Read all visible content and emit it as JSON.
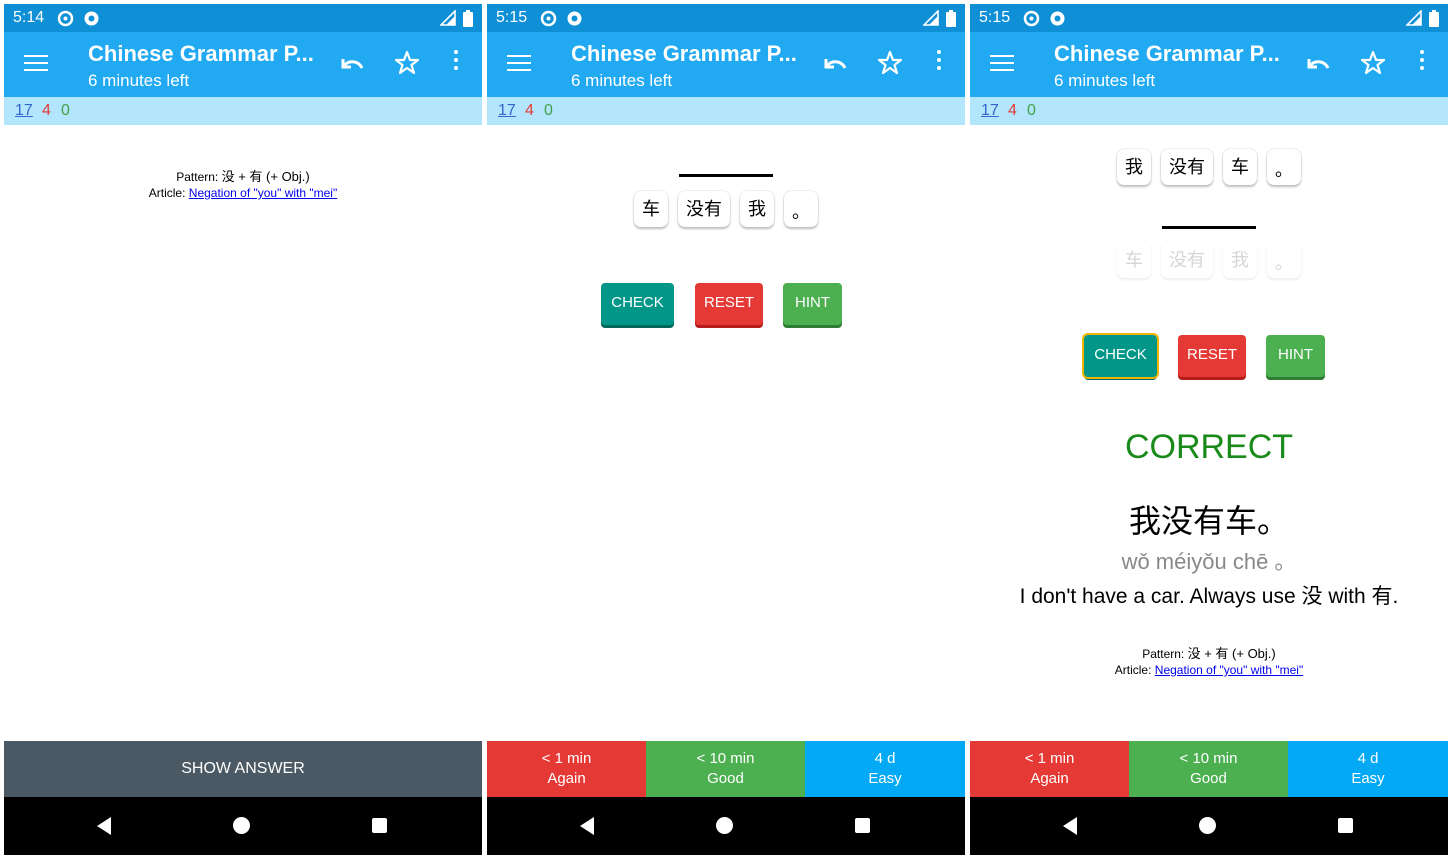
{
  "status": {
    "time1": "5:14",
    "time2": "5:15",
    "time3": "5:15"
  },
  "app": {
    "title": "Chinese Grammar P...",
    "subtitle": "6 minutes left"
  },
  "counts": {
    "new": "17",
    "learning": "4",
    "review": "0"
  },
  "pattern": {
    "label": "Pattern:",
    "value": "没 + 有 (+ Obj.)",
    "article_label": "Article:",
    "article_link": "Negation of \"you\" with \"mei\""
  },
  "question_tiles": [
    "车",
    "没有",
    "我",
    "。"
  ],
  "answer_tiles": [
    "我",
    "没有",
    "车",
    "。"
  ],
  "buttons": {
    "check": "CHECK",
    "reset": "RESET",
    "hint": "HINT",
    "show_answer": "SHOW ANSWER"
  },
  "ease": {
    "again": {
      "time": "< 1 min",
      "label": "Again"
    },
    "good": {
      "time": "< 10 min",
      "label": "Good"
    },
    "easy": {
      "time": "4 d",
      "label": "Easy"
    }
  },
  "result": {
    "verdict": "CORRECT",
    "hanzi": "我没有车。",
    "pinyin": "wǒ méiyǒu chē 。",
    "english": "I don't have a car. Always use 没 with 有."
  },
  "colors": {
    "appbar": "#21a9f2",
    "statusbar": "#0e8fd6",
    "countbar": "#b3e5fc",
    "correct": "#1a8a1a"
  }
}
